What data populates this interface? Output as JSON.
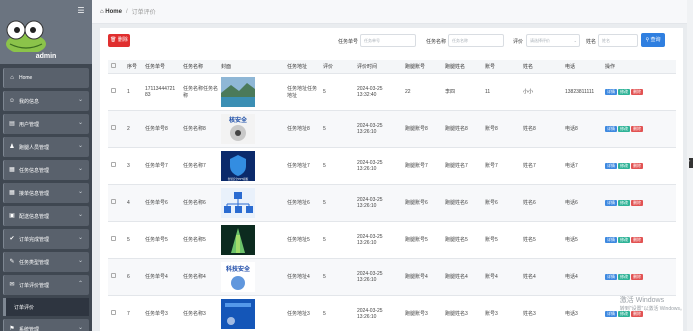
{
  "sidebar": {
    "admin": "admin",
    "items": [
      {
        "label": "Home",
        "icon": "home-icon",
        "glyph": "⌂"
      },
      {
        "label": "我的信息",
        "icon": "user-icon",
        "glyph": "☺"
      },
      {
        "label": "用户管理",
        "icon": "users-icon",
        "glyph": "▤"
      },
      {
        "label": "跑腿人员管理",
        "icon": "person-icon",
        "glyph": "♟"
      },
      {
        "label": "任务信息管理",
        "icon": "grid-icon",
        "glyph": "▦"
      },
      {
        "label": "接单信息管理",
        "icon": "grid-icon",
        "glyph": "▦"
      },
      {
        "label": "配送信息管理",
        "icon": "box-icon",
        "glyph": "▣"
      },
      {
        "label": "订单完成管理",
        "icon": "check-icon",
        "glyph": "✔"
      },
      {
        "label": "任务类型管理",
        "icon": "tag-icon",
        "glyph": "✎"
      },
      {
        "label": "订单评价管理",
        "icon": "comment-icon",
        "glyph": "✉"
      }
    ],
    "submenu": "订单评价",
    "last": {
      "label": "系统管理",
      "icon": "location-icon",
      "glyph": "⚑"
    }
  },
  "breadcrumb": {
    "home": "Home",
    "sep": "/",
    "current": "订单评价"
  },
  "toolbar": {
    "delete": "删除",
    "f1_label": "任务单号",
    "f1_placeholder": "任务单号",
    "f2_label": "任务名称",
    "f2_placeholder": "任务名称",
    "f3_label": "评价",
    "f3_placeholder": "请选择评价",
    "f4_label": "姓名",
    "f4_placeholder": "姓名",
    "search": "查询"
  },
  "table": {
    "headers": [
      "",
      "序号",
      "任务单号",
      "任务名称",
      "封面",
      "任务地址",
      "评价",
      "评价时间",
      "跑腿账号",
      "跑腿姓名",
      "账号",
      "姓名",
      "电话",
      "操作"
    ],
    "actions": {
      "detail": "详情",
      "edit": "修改",
      "delete": "删除"
    },
    "rows": [
      {
        "no": "1",
        "order": "17113444721 83",
        "name": "任务名称任务名称",
        "addr": "任务地址任务地址",
        "rate": "5",
        "time": "2024-03-25 13:32:40",
        "runner": "22",
        "rname": "李四",
        "acc": "11",
        "uname": "小小",
        "phone": "13823811111",
        "thumb": "lake"
      },
      {
        "no": "2",
        "order": "任务单号8",
        "name": "任务名称8",
        "addr": "任务地址8",
        "rate": "5",
        "time": "2024-03-25 13:26:10",
        "runner": "跑腿账号8",
        "rname": "跑腿姓名8",
        "acc": "账号8",
        "uname": "姓名8",
        "phone": "电话8",
        "thumb": "safety"
      },
      {
        "no": "3",
        "order": "任务单号7",
        "name": "任务名称7",
        "addr": "任务地址7",
        "rate": "5",
        "time": "2024-03-25 13:26:10",
        "runner": "跑腿账号7",
        "rname": "跑腿姓名7",
        "acc": "账号7",
        "uname": "姓名7",
        "phone": "电话7",
        "thumb": "shield"
      },
      {
        "no": "4",
        "order": "任务单号6",
        "name": "任务名称6",
        "addr": "任务地址6",
        "rate": "5",
        "time": "2024-03-25 13:26:10",
        "runner": "跑腿账号6",
        "rname": "跑腿姓名6",
        "acc": "账号6",
        "uname": "姓名6",
        "phone": "电话6",
        "thumb": "network"
      },
      {
        "no": "5",
        "order": "任务单号5",
        "name": "任务名称5",
        "addr": "任务地址5",
        "rate": "5",
        "time": "2024-03-25 13:26:10",
        "runner": "跑腿账号5",
        "rname": "跑腿姓名5",
        "acc": "账号5",
        "uname": "姓名5",
        "phone": "电话5",
        "thumb": "tower"
      },
      {
        "no": "6",
        "order": "任务单号4",
        "name": "任务名称4",
        "addr": "任务地址4",
        "rate": "5",
        "time": "2024-03-25 13:26:10",
        "runner": "跑腿账号4",
        "rname": "跑腿姓名4",
        "acc": "账号4",
        "uname": "姓名4",
        "phone": "电话4",
        "thumb": "tech"
      },
      {
        "no": "7",
        "order": "任务单号3",
        "name": "任务名称3",
        "addr": "任务地址3",
        "rate": "5",
        "time": "2024-03-25 13:26:10",
        "runner": "跑腿账号3",
        "rname": "跑腿姓名3",
        "acc": "账号3",
        "uname": "姓名3",
        "phone": "电话3",
        "thumb": "blue"
      }
    ]
  },
  "thumb_text": {
    "safety": "核安全",
    "tech": "科技安全",
    "shield": "智慧安全PPT模板"
  },
  "watermark": {
    "line1": "激活 Windows",
    "line2": "转到\"设置\"以激活 Windows。"
  }
}
